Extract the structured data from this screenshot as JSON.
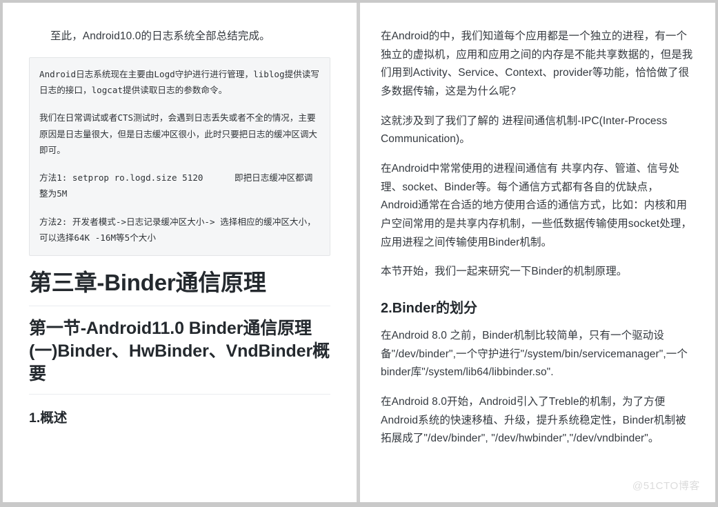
{
  "document": {
    "left_column": {
      "intro_paragraph": "至此，Android10.0的日志系统全部总结完成。",
      "code_block": [
        "Android日志系统现在主要由Logd守护进行进行管理，liblog提供读写日志的接口，logcat提供读取日志的参数命令。",
        "我们在日常调试或者CTS测试时，会遇到日志丢失或者不全的情况，主要原因是日志量很大，但是日志缓冲区很小，此时只要把日志的缓冲区调大即可。",
        "方法1: setprop ro.logd.size 5120      即把日志缓冲区都调整为5M",
        "方法2: 开发者模式->日志记录缓冲区大小-> 选择相应的缓冲区大小，可以选择64K -16M等5个大小"
      ],
      "heading_1": "第三章-Binder通信原理",
      "heading_2": "第一节-Android11.0 Binder通信原理(一)Binder、HwBinder、VndBinder概要",
      "heading_3": "1.概述"
    },
    "right_column": {
      "paragraph_1": "在Android的中，我们知道每个应用都是一个独立的进程，有一个独立的虚拟机，应用和应用之间的内存是不能共享数据的，但是我们用到Activity、Service、Context、provider等功能，恰恰做了很多数据传输，这是为什么呢?",
      "paragraph_2": "这就涉及到了我们了解的 进程间通信机制-IPC(Inter-Process Communication)。",
      "paragraph_3": "在Android中常常使用的进程间通信有 共享内存、管道、信号处理、socket、Binder等。每个通信方式都有各自的优缺点，Android通常在合适的地方使用合适的通信方式，比如：内核和用户空间常用的是共享内存机制，一些低数据传输使用socket处理，应用进程之间传输使用Binder机制。",
      "paragraph_4": "本节开始，我们一起来研究一下Binder的机制原理。",
      "heading_2_binder": "2.Binder的划分",
      "paragraph_5": "在Android 8.0 之前，Binder机制比较简单，只有一个驱动设备\"/dev/binder\",一个守护进行\"/system/bin/servicemanager\",一个binder库\"/system/lib64/libbinder.so\".",
      "paragraph_6": "在Android 8.0开始，Android引入了Treble的机制，为了方便Android系统的快速移植、升级，提升系统稳定性，Binder机制被拓展成了\"/dev/binder\", \"/dev/hwbinder\",\"/dev/vndbinder\"。"
    },
    "watermark": "@51CTO博客",
    "colors": {
      "page_background": "#ffffff",
      "frame": "#c9c9c9",
      "divider": "#cfcfcf",
      "code_background": "#f5f6f7",
      "code_border": "#e3e5e7",
      "heading_color": "#24292e",
      "body_color": "#34393f",
      "rule_color": "#eaecef",
      "watermark_color": "#dcdcdc"
    }
  }
}
